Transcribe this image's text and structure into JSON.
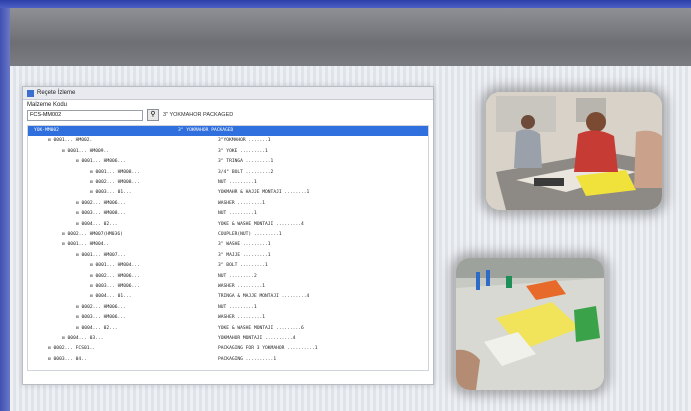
{
  "window": {
    "title": "Reçete İzleme"
  },
  "field": {
    "label": "Malzeme Kodu",
    "value": "FCS-MM002",
    "description": "3\" YOKMAHOR PACKAGED"
  },
  "tree": [
    {
      "code": "YOK-MM002",
      "desc": "3\" YOKMAHOR PACKAGED",
      "qty": "",
      "indent": 0,
      "selected": true
    },
    {
      "code": "0001... HM002.",
      "desc": "3\"YOKMAHOR",
      "qty": ".......1",
      "indent": 1
    },
    {
      "code": "0001... HM009..",
      "desc": "3\" YOKE",
      "qty": ".........1",
      "indent": 2
    },
    {
      "code": "0001... HM006...",
      "desc": "3\" TRINGA",
      "qty": ".........1",
      "indent": 3
    },
    {
      "code": "0001... HM008...",
      "desc": "3/4\" BOLT",
      "qty": ".........2",
      "indent": 4
    },
    {
      "code": "0002... HM008...",
      "desc": "NUT",
      "qty": ".........1",
      "indent": 4
    },
    {
      "code": "0003... 01...",
      "desc": "YOKMAHR & HAJJE MONTAJI",
      "qty": "........1",
      "indent": 4
    },
    {
      "code": "0002... HM006...",
      "desc": "WASHER",
      "qty": ".........1",
      "indent": 3
    },
    {
      "code": "0003... HM008...",
      "desc": "NUT",
      "qty": ".........1",
      "indent": 3
    },
    {
      "code": "0004... 02...",
      "desc": "YOKE & WASHE MONTAJI",
      "qty": ".........4",
      "indent": 3
    },
    {
      "code": "0002... HM007(HM036)",
      "desc": "COUPLER(NUT)",
      "qty": ".........1",
      "indent": 2
    },
    {
      "code": "0001... HM004..",
      "desc": "3\" WASHE",
      "qty": ".........1",
      "indent": 2
    },
    {
      "code": "0001... HM007...",
      "desc": "3\" MAJJE",
      "qty": ".........1",
      "indent": 3
    },
    {
      "code": "0001... HM004...",
      "desc": "3\" BOLT",
      "qty": ".........1",
      "indent": 4
    },
    {
      "code": "0002... HM006...",
      "desc": "NUT",
      "qty": ".........2",
      "indent": 4
    },
    {
      "code": "0003... HM006...",
      "desc": "WASHER",
      "qty": ".........1",
      "indent": 4
    },
    {
      "code": "0004... 01...",
      "desc": "TRINGA & MAJJE MONTAJI",
      "qty": ".........4",
      "indent": 4
    },
    {
      "code": "0002... HM006...",
      "desc": "NUT",
      "qty": ".........1",
      "indent": 3
    },
    {
      "code": "0003... HM006...",
      "desc": "WASHER",
      "qty": ".........1",
      "indent": 3
    },
    {
      "code": "0004... 02...",
      "desc": "YOKE & WASHE MONTAJI",
      "qty": ".........6",
      "indent": 3
    },
    {
      "code": "0004... 03...",
      "desc": "YOKMAHOR MONTAJI",
      "qty": "..........4",
      "indent": 2
    },
    {
      "code": "0002... FCS01..",
      "desc": "PACKAGING FOR 3 YOKMAHOR",
      "qty": "..........1",
      "indent": 1
    },
    {
      "code": "0003... 04..",
      "desc": "PACKAGING",
      "qty": "..........1",
      "indent": 1
    }
  ],
  "colors": {
    "accent": "#2f6fde",
    "header": "#7a7c82",
    "frame": "#4050b0"
  }
}
